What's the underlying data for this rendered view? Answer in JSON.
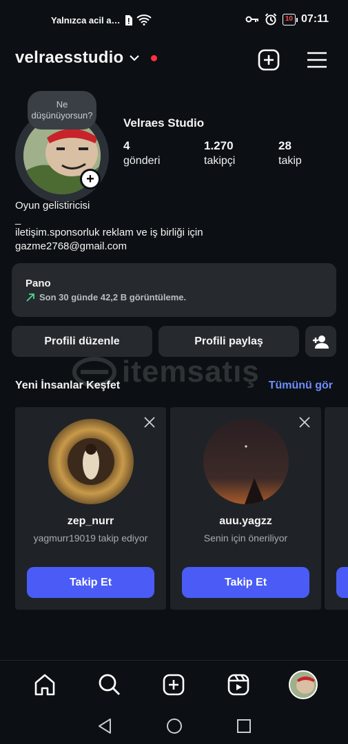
{
  "status_bar": {
    "carrier_text": "Yalnızca acil a…",
    "battery_level": "10",
    "time": "07:11"
  },
  "header": {
    "username": "velraesstudio"
  },
  "profile": {
    "thought_bubble": "Ne düşünüyorsun?",
    "display_name": "Velraes Studio",
    "stats": [
      {
        "value": "4",
        "label": "gönderi"
      },
      {
        "value": "1.270",
        "label": "takipçi"
      },
      {
        "value": "28",
        "label": "takip"
      }
    ],
    "bio_lines": [
      "Oyun gelistiricisi",
      "_",
      "iletişim.sponsorluk reklam  ve iş birliği için",
      "gazme2768@gmail.com"
    ]
  },
  "dashboard": {
    "title": "Pano",
    "subtitle": "Son 30 günde 42,2 B görüntüleme."
  },
  "actions": {
    "edit_profile": "Profili düzenle",
    "share_profile": "Profili paylaş"
  },
  "discover": {
    "title": "Yeni İnsanlar Keşfet",
    "see_all": "Tümünü gör",
    "cards": [
      {
        "name": "zep_nurr",
        "subtitle": "yagmurr19019 takip ediyor",
        "button": "Takip Et"
      },
      {
        "name": "auu.yagzz",
        "subtitle": "Senin için öneriliyor",
        "button": "Takip Et"
      }
    ]
  },
  "watermark": {
    "text": "itemsatış"
  },
  "colors": {
    "background": "#0c1014",
    "accent": "#4a5cf5",
    "link": "#708dff",
    "notification": "#ff3040"
  }
}
